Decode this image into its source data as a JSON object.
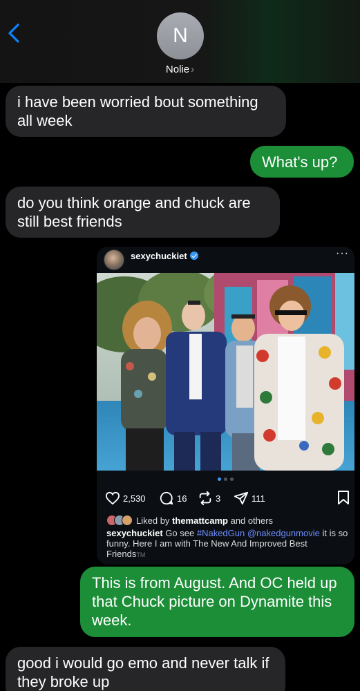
{
  "header": {
    "avatar_initial": "N",
    "contact_name": "Nolie",
    "chevron": "›",
    "back_icon": "chevron-left-icon"
  },
  "messages": [
    {
      "from": "them",
      "text": "i have been worried bout something all week"
    },
    {
      "from": "me",
      "text": "What's up?"
    },
    {
      "from": "them",
      "text": "do you think orange and chuck are still best friends"
    },
    {
      "from": "me",
      "text": "This is from August. And OC held up that Chuck picture on Dynamite this week."
    },
    {
      "from": "them",
      "text": "good i would go emo and never talk if they broke up"
    }
  ],
  "post": {
    "username": "sexychuckiet",
    "more": "···",
    "likes_count": "2,530",
    "comments_count": "16",
    "reposts_count": "3",
    "shares_count": "111",
    "liked_by_prefix": "Liked by",
    "liked_by_user": "themattcamp",
    "liked_by_suffix": "and others",
    "caption_user": "sexychuckiet",
    "caption_text_1": "Go see",
    "caption_hashtag": "#NakedGun",
    "caption_mention": "@nakedgunmovie",
    "caption_text_2": "it is so funny. Here I am with The New And Improved Best Friends",
    "caption_tm": "TM",
    "carousel_index": 1,
    "carousel_total": 3
  },
  "colors": {
    "incoming_bubble": "#262628",
    "outgoing_bubble": "#1b8e37",
    "ios_blue": "#0a84ff",
    "link_blue": "#6e8cff"
  }
}
